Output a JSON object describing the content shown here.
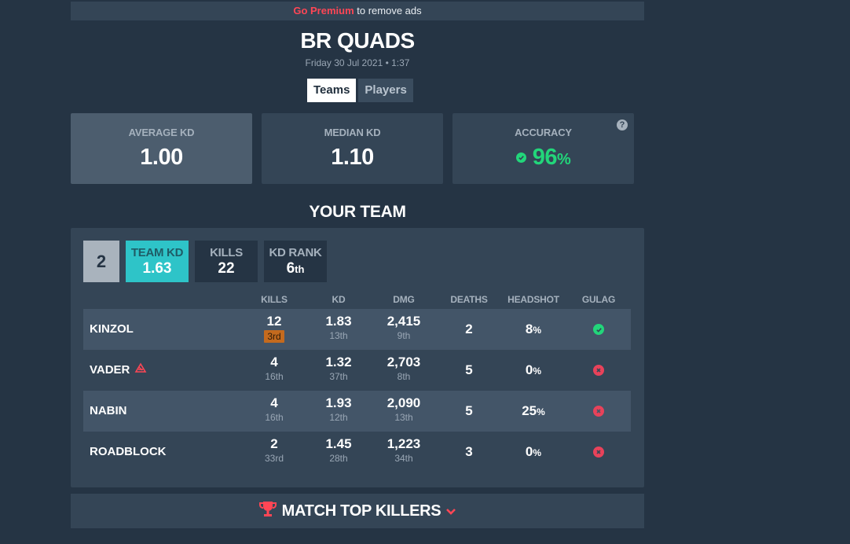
{
  "ad": {
    "premium_link": "Go Premium",
    "suffix": " to remove ads"
  },
  "match": {
    "title": "BR QUADS",
    "datetime": "Friday 30 Jul 2021 • 1:37"
  },
  "tabs": [
    {
      "label": "Teams",
      "active": true
    },
    {
      "label": "Players",
      "active": false
    }
  ],
  "stats": {
    "average_kd": {
      "label": "AVERAGE KD",
      "value": "1.00"
    },
    "median_kd": {
      "label": "MEDIAN KD",
      "value": "1.10"
    },
    "accuracy": {
      "label": "ACCURACY",
      "value": "96",
      "unit": "%",
      "help": "?"
    }
  },
  "team": {
    "section_title": "YOUR TEAM",
    "position": "2",
    "team_kd": {
      "label": "TEAM KD",
      "value": "1.63"
    },
    "kills": {
      "label": "KILLS",
      "value": "22"
    },
    "kd_rank": {
      "label": "KD RANK",
      "value": "6",
      "suffix": "th"
    },
    "columns": [
      "KILLS",
      "KD",
      "DMG",
      "DEATHS",
      "HEADSHOT",
      "GULAG"
    ],
    "players": [
      {
        "name": "KINZOL",
        "kills": "12",
        "kills_rank": "3rd",
        "kd": "1.83",
        "kd_rank": "13th",
        "dmg": "2,415",
        "dmg_rank": "9th",
        "deaths": "2",
        "headshot": "8",
        "gulag": "win"
      },
      {
        "name": "VADER",
        "kills": "4",
        "kills_rank": "16th",
        "kd": "1.32",
        "kd_rank": "37th",
        "dmg": "2,703",
        "dmg_rank": "8th",
        "deaths": "5",
        "headshot": "0",
        "gulag": "loss"
      },
      {
        "name": "NABIN",
        "kills": "4",
        "kills_rank": "16th",
        "kd": "1.93",
        "kd_rank": "12th",
        "dmg": "2,090",
        "dmg_rank": "13th",
        "deaths": "5",
        "headshot": "25",
        "gulag": "loss"
      },
      {
        "name": "ROADBLOCK",
        "kills": "2",
        "kills_rank": "33rd",
        "kd": "1.45",
        "kd_rank": "28th",
        "dmg": "1,223",
        "dmg_rank": "34th",
        "deaths": "3",
        "headshot": "0",
        "gulag": "loss"
      }
    ]
  },
  "top_killers": {
    "label": "MATCH TOP KILLERS"
  },
  "colors": {
    "background": "#253444",
    "panel": "#344556",
    "accent_teal": "#2ec4c8",
    "brand_red": "#ff4655",
    "success": "#22d67a",
    "danger": "#e8425a",
    "bronze": "#c46a1e"
  },
  "icons": {
    "help": "help-icon",
    "check": "check-circle-icon",
    "cross": "x-circle-icon",
    "trophy": "trophy-icon",
    "chevron": "chevron-down-icon",
    "badge": "player-badge-icon"
  }
}
